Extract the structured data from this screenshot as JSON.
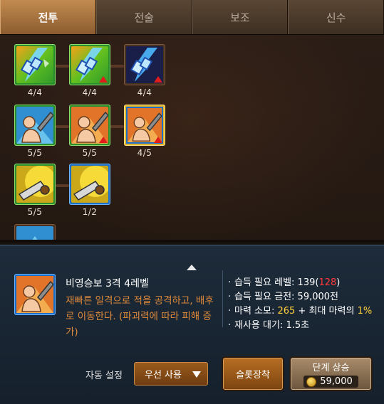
{
  "tabs": [
    "전투",
    "전술",
    "보조",
    "신수"
  ],
  "skill_tree": {
    "rows": [
      [
        {
          "level": "4/4",
          "frame": "green",
          "icon": "blue-crystal-skill-icon",
          "upgradable": false
        },
        {
          "level": "4/4",
          "frame": "green",
          "icon": "blue-crystal-skill-icon",
          "upgradable": true
        },
        {
          "level": "4/4",
          "frame": "brown",
          "icon": "blue-crystal-skill-icon",
          "upgradable": true
        }
      ],
      [
        {
          "level": "5/5",
          "frame": "green",
          "icon": "dash-strike-skill-icon",
          "upgradable": false
        },
        {
          "level": "5/5",
          "frame": "green",
          "icon": "dash-strike-skill-icon",
          "upgradable": true
        },
        {
          "level": "4/5",
          "frame": "gold",
          "icon": "dash-strike-skill-icon",
          "upgradable": true
        }
      ],
      [
        {
          "level": "5/5",
          "frame": "green",
          "icon": "sword-slash-skill-icon",
          "upgradable": false
        },
        {
          "level": "1/2",
          "frame": "blue",
          "icon": "sword-slash-skill-icon",
          "upgradable": false
        }
      ]
    ]
  },
  "detail": {
    "name": "비영승보 3격 4레벨",
    "description": "재빠른 일격으로 적을 공격하고, 배후로 이동한다. (파괴력에 따라 피해 증가)",
    "stats": {
      "req_level_label": "습득 필요 레벨: ",
      "req_level": "139",
      "req_level_current": "128",
      "req_gold_label": "습득 필요 금전: ",
      "req_gold": "59,000전",
      "mana_label": "마력 소모: ",
      "mana_value": "265",
      "mana_extra": " + 최대 마력의 ",
      "mana_percent": "1%",
      "cooldown_label": "재사용 대기: ",
      "cooldown": "1.5초"
    }
  },
  "controls": {
    "auto_label": "자동 설정",
    "dropdown_value": "우선 사용",
    "slot_button": "슬롯장착",
    "upgrade_button": "단계 상승",
    "upgrade_cost": "59,000"
  },
  "colors": {
    "active_tab": "#c28a4f",
    "frame_green": "#2a8d2e",
    "frame_blue": "#1b6fc9",
    "frame_gold": "#e3b52b",
    "desc_text": "#e08a3a",
    "red": "#ff3838",
    "yellow": "#ffd23a"
  }
}
